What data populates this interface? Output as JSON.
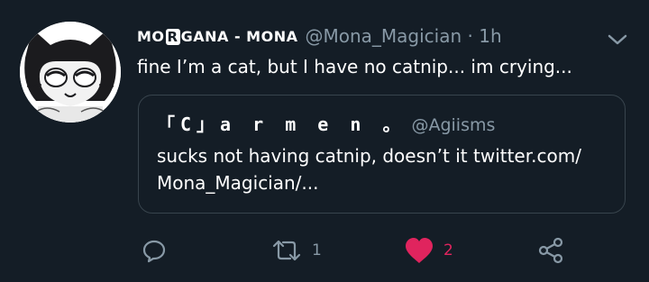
{
  "tweet": {
    "avatar_icon": "cat-avatar",
    "name_part1": "MO",
    "name_badge": "R",
    "name_part2": "GANA - MONA",
    "handle_time": "@Mona_Magician · 1h",
    "text": "fine I’m a cat, but I have no catnip... im crying...",
    "menu_icon": "chevron-down-icon"
  },
  "quote": {
    "display_name": "「C」a r m e n 。",
    "handle": "@Agiisms",
    "text_line1": "sucks not having catnip, doesn’t it twitter.com/",
    "text_line2": "Mona_Magician/..."
  },
  "actions": {
    "reply_icon": "reply-icon",
    "retweet_icon": "retweet-icon",
    "retweet_count": "1",
    "like_icon": "heart-icon",
    "like_count": "2",
    "share_icon": "share-icon"
  },
  "colors": {
    "background": "#141d26",
    "secondary_text": "#8899a6",
    "border": "#38444d",
    "like": "#e0245e"
  }
}
